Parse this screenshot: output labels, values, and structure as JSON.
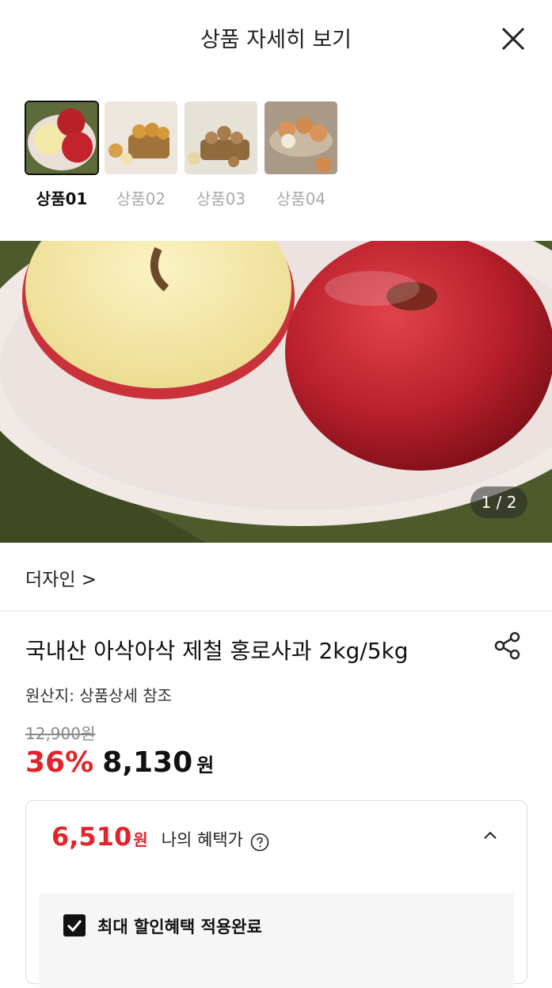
{
  "header": {
    "title": "상품 자세히 보기"
  },
  "thumbnails": [
    {
      "label": "상품01",
      "selected": true,
      "icon": "apple-thumbnail"
    },
    {
      "label": "상품02",
      "selected": false,
      "icon": "pear-basket-thumbnail"
    },
    {
      "label": "상품03",
      "selected": false,
      "icon": "potato-basket-thumbnail"
    },
    {
      "label": "상품04",
      "selected": false,
      "icon": "onion-bowl-thumbnail"
    }
  ],
  "gallery": {
    "pager": "1 / 2"
  },
  "design": {
    "label": "더자인 >"
  },
  "product": {
    "title": "국내산 아삭아삭 제철 홍로사과 2kg/5kg",
    "origin": "원산지: 상품상세 참조",
    "original_price": "12,900원",
    "discount": "36%",
    "sale_price": "8,130",
    "sale_unit": "원"
  },
  "benefit": {
    "price": "6,510",
    "unit": "원",
    "label": "나의 혜택가",
    "max_discount_label": "최대 할인혜택 적용완료",
    "checked": true
  },
  "colors": {
    "accent_red": "#e0242b",
    "text": "#111111"
  }
}
